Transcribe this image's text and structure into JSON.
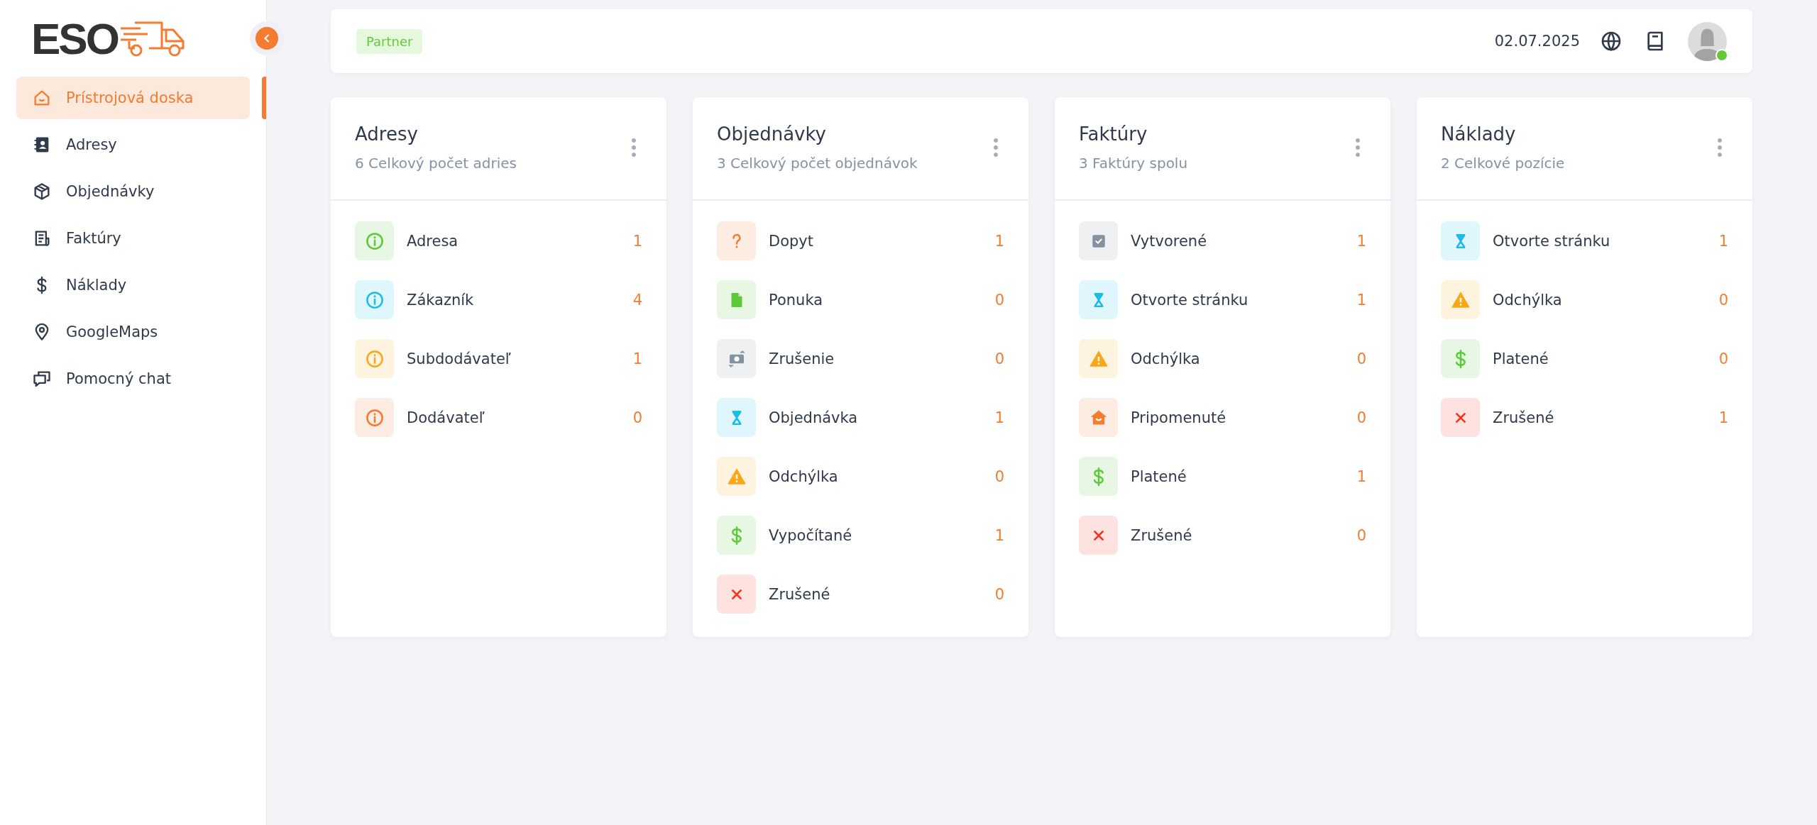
{
  "sidebar": {
    "logo": "ESO",
    "items": [
      {
        "label": "Prístrojová doska",
        "selected": true
      },
      {
        "label": "Adresy",
        "selected": false
      },
      {
        "label": "Objednávky",
        "selected": false
      },
      {
        "label": "Faktúry",
        "selected": false
      },
      {
        "label": "Náklady",
        "selected": false
      },
      {
        "label": "GoogleMaps",
        "selected": false
      },
      {
        "label": "Pomocný chat",
        "selected": false
      }
    ]
  },
  "header": {
    "badge": "Partner",
    "date": "02.07.2025",
    "user": {
      "online": true
    }
  },
  "cards": [
    {
      "title": "Adresy",
      "subtitle": "6 Celkový počet adries",
      "rows": [
        {
          "kind": "info",
          "color": "#5cc93a",
          "label": "Adresa",
          "value": "1"
        },
        {
          "kind": "info",
          "color": "#1bbde8",
          "label": "Zákazník",
          "value": "4"
        },
        {
          "kind": "info",
          "color": "#f9a719",
          "label": "Subdodávateľ",
          "value": "1"
        },
        {
          "kind": "info",
          "color": "#f47b30",
          "label": "Dodávateľ",
          "value": "0"
        }
      ]
    },
    {
      "title": "Objednávky",
      "subtitle": "3 Celkový počet objednávok",
      "rows": [
        {
          "kind": "question",
          "color": "#f47b30",
          "label": "Dopyt",
          "value": "1"
        },
        {
          "kind": "file",
          "color": "#5cc93a",
          "label": "Ponuka",
          "value": "0"
        },
        {
          "kind": "money",
          "color": "#8592a3",
          "label": "Zrušenie",
          "value": "0"
        },
        {
          "kind": "hourglass",
          "color": "#1bbde8",
          "label": "Objednávka",
          "value": "1"
        },
        {
          "kind": "warning",
          "color": "#f9a719",
          "label": "Odchýlka",
          "value": "0"
        },
        {
          "kind": "dollar",
          "color": "#5cc93a",
          "label": "Vypočítané",
          "value": "1"
        },
        {
          "kind": "cross",
          "color": "#f5321e",
          "label": "Zrušené",
          "value": "0"
        }
      ]
    },
    {
      "title": "Faktúry",
      "subtitle": "3 Faktúry spolu",
      "rows": [
        {
          "kind": "checkbox",
          "color": "#8592a3",
          "label": "Vytvorené",
          "value": "1"
        },
        {
          "kind": "hourglass",
          "color": "#1bbde8",
          "label": "Otvorte stránku",
          "value": "1"
        },
        {
          "kind": "warning",
          "color": "#f9a719",
          "label": "Odchýlka",
          "value": "0"
        },
        {
          "kind": "house",
          "color": "#f47b30",
          "label": "Pripomenuté",
          "value": "0"
        },
        {
          "kind": "dollar",
          "color": "#5cc93a",
          "label": "Platené",
          "value": "1"
        },
        {
          "kind": "cross",
          "color": "#f5321e",
          "label": "Zrušené",
          "value": "0"
        }
      ]
    },
    {
      "title": "Náklady",
      "subtitle": "2 Celkové pozície",
      "rows": [
        {
          "kind": "hourglass",
          "color": "#1bbde8",
          "label": "Otvorte stránku",
          "value": "1"
        },
        {
          "kind": "warning",
          "color": "#f9a719",
          "label": "Odchýlka",
          "value": "0"
        },
        {
          "kind": "dollar",
          "color": "#5cc93a",
          "label": "Platené",
          "value": "0"
        },
        {
          "kind": "cross",
          "color": "#f5321e",
          "label": "Zrušené",
          "value": "1"
        }
      ]
    }
  ]
}
